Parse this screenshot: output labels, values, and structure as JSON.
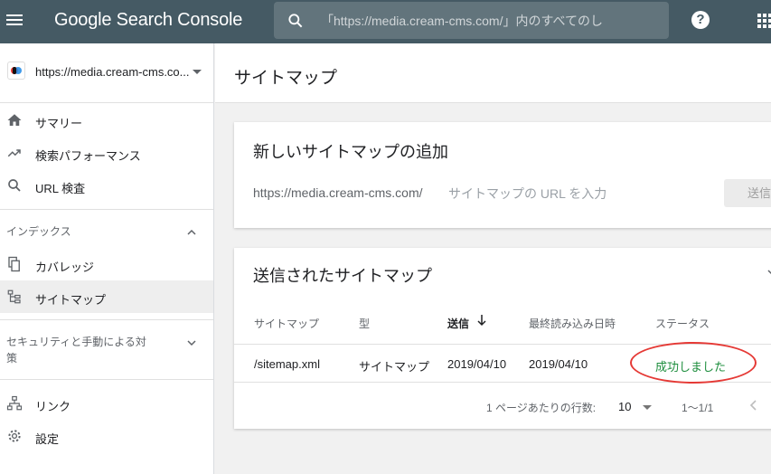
{
  "header": {
    "app_title": "Google Search Console",
    "search_placeholder": "「https://media.cream-cms.com/」内のすべてのし",
    "help_glyph": "?"
  },
  "sidebar": {
    "property_url": "https://media.cream-cms.co...",
    "items_top": [
      {
        "label": "サマリー",
        "icon": "home-icon"
      },
      {
        "label": "検索パフォーマンス",
        "icon": "trending-up-icon"
      },
      {
        "label": "URL 検査",
        "icon": "search-icon"
      }
    ],
    "index_section": {
      "title": "インデックス",
      "items": [
        {
          "label": "カバレッジ",
          "icon": "file-copy-icon"
        },
        {
          "label": "サイトマップ",
          "icon": "sitemap-icon",
          "active": true
        }
      ]
    },
    "security_section": {
      "title_line1": "セキュリティと手動による対",
      "title_line2": "策"
    },
    "items_bottom": [
      {
        "label": "リンク",
        "icon": "links-icon"
      },
      {
        "label": "設定",
        "icon": "gear-icon"
      }
    ]
  },
  "page": {
    "title": "サイトマップ"
  },
  "add_card": {
    "title": "新しいサイトマップの追加",
    "url_prefix": "https://media.cream-cms.com/",
    "input_placeholder": "サイトマップの URL を入力",
    "submit_label": "送信"
  },
  "list_card": {
    "title": "送信されたサイトマップ",
    "columns": [
      "サイトマップ",
      "型",
      "送信",
      "最終読み込み日時",
      "ステータス"
    ],
    "sorted_column": "送信",
    "rows": [
      {
        "sitemap": "/sitemap.xml",
        "type": "サイトマップ",
        "submitted": "2019/04/10",
        "last_read": "2019/04/10",
        "status": "成功しました"
      }
    ],
    "pagination": {
      "rows_per_page_label": "1 ページあたりの行数:",
      "rows_per_page": "10",
      "range": "1〜1/1"
    }
  },
  "colors": {
    "topbar": "#455a64",
    "status_success": "#1e8e3e",
    "annotation_circle": "#e53935"
  }
}
